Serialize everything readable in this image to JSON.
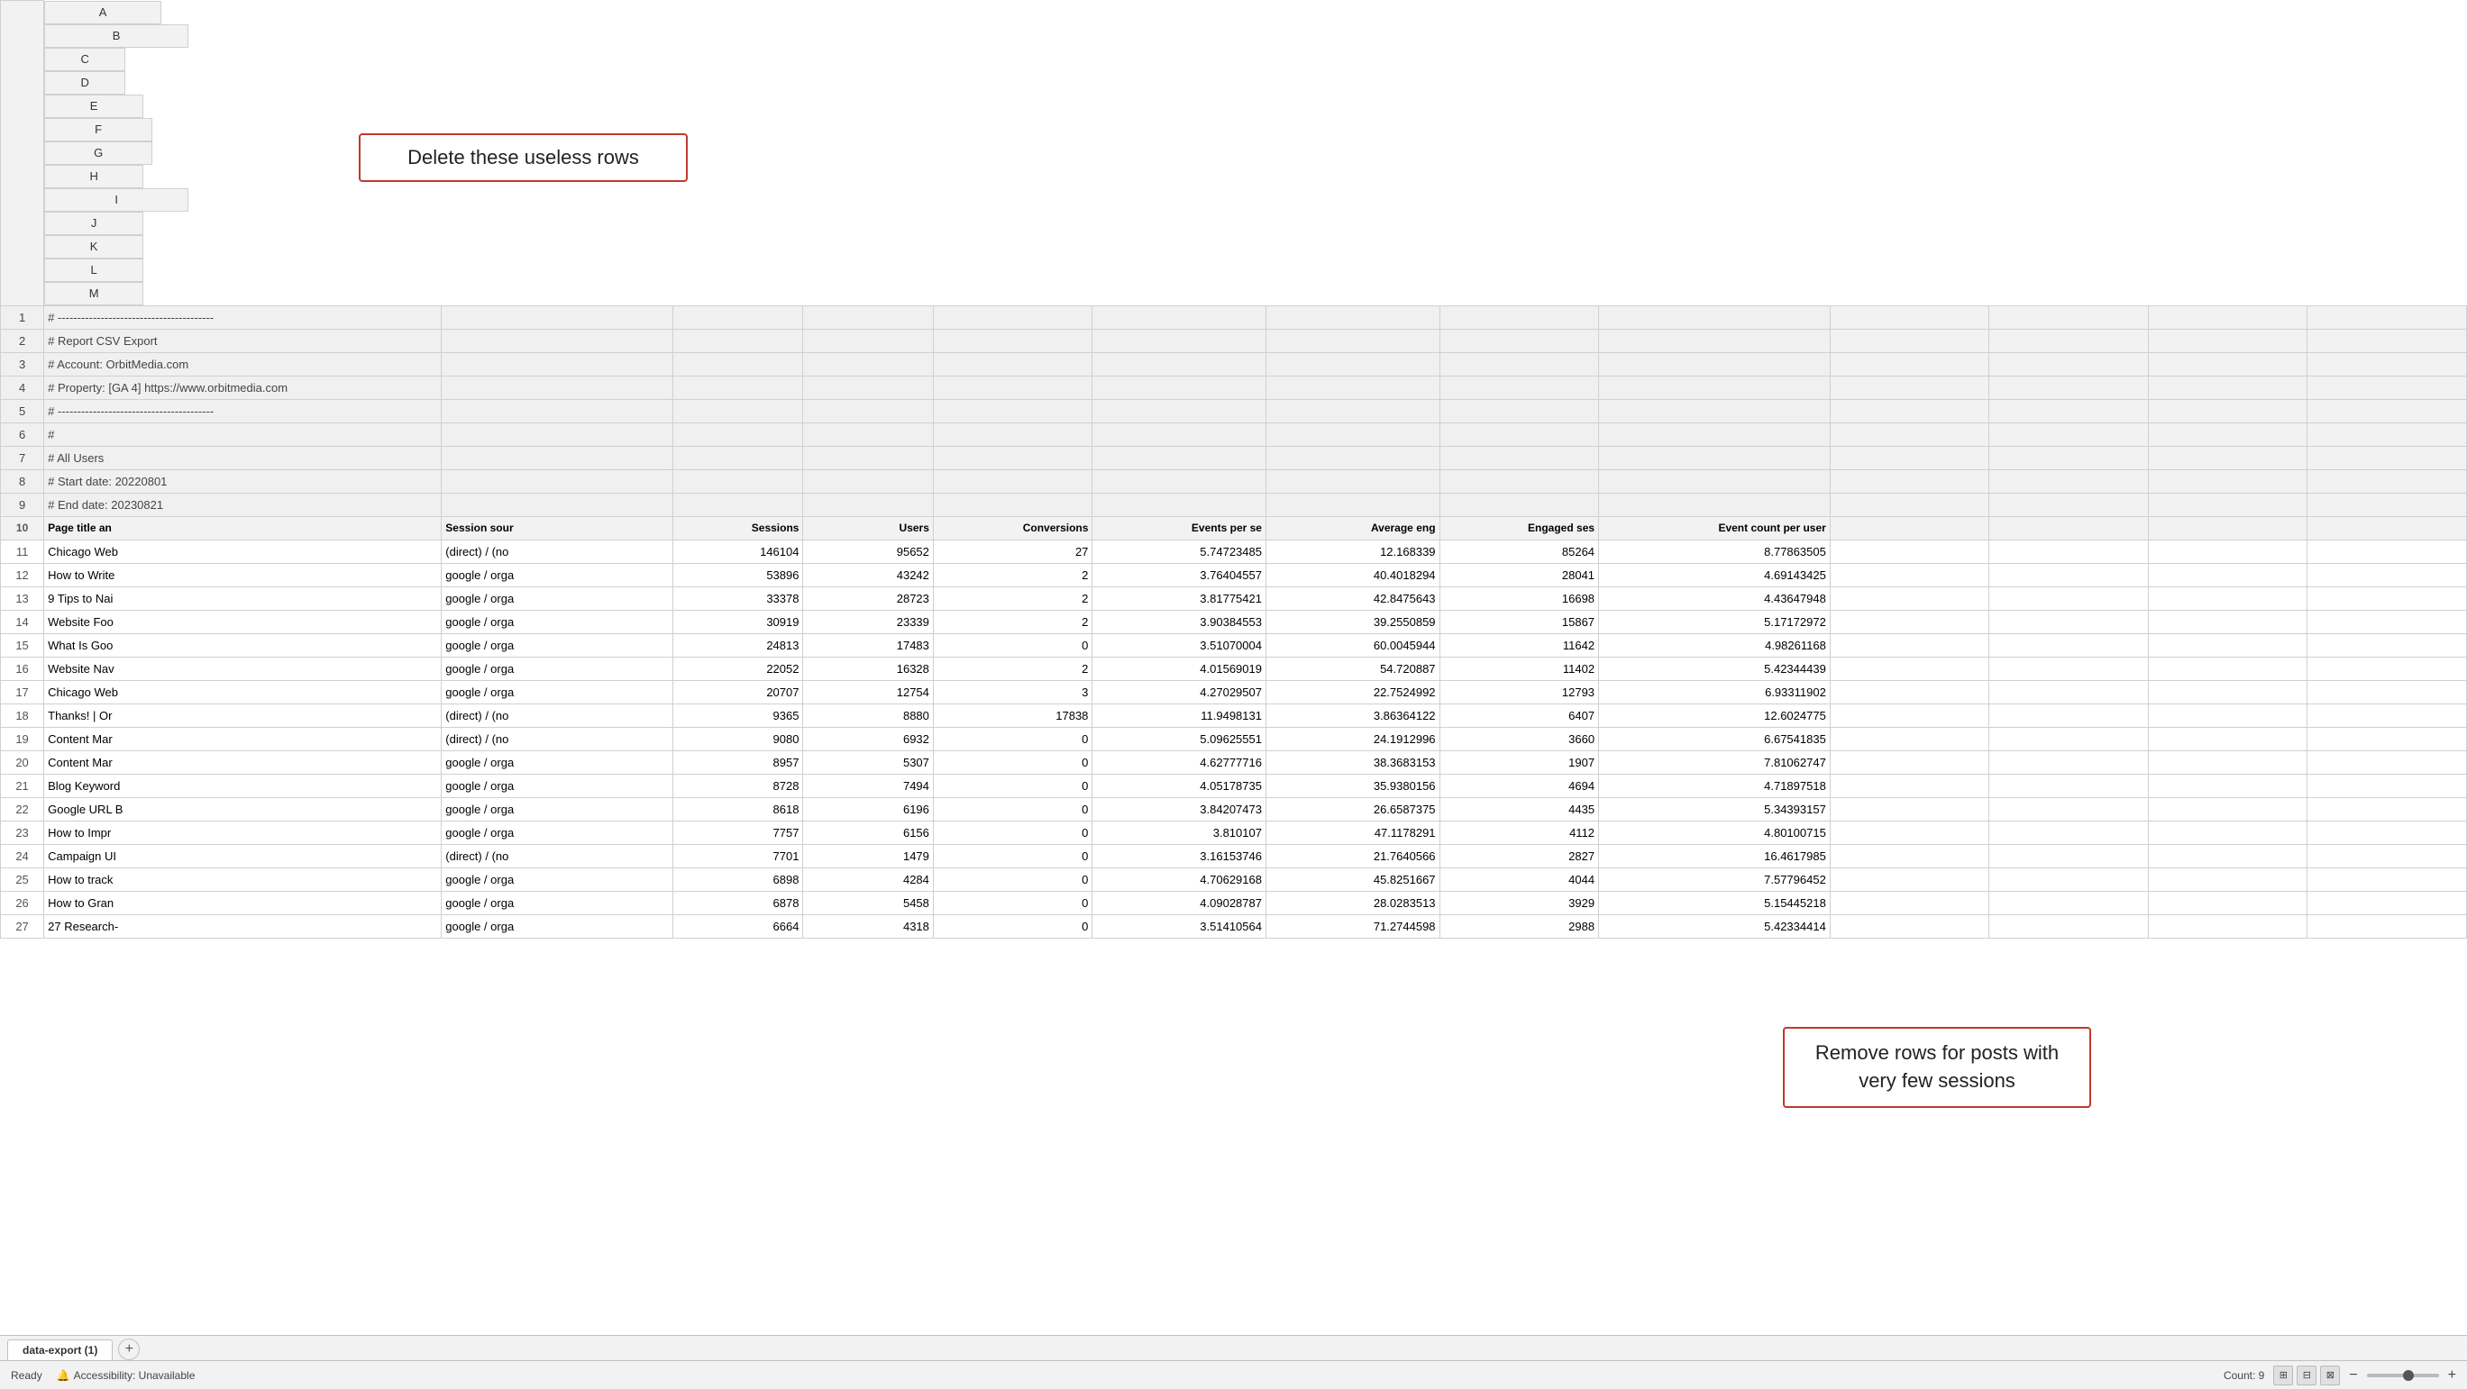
{
  "columns": {
    "row_num": "",
    "A": "A",
    "B": "B",
    "C": "C",
    "D": "D",
    "E": "E",
    "F": "F",
    "G": "G",
    "H": "H",
    "I": "I",
    "J": "J",
    "K": "K",
    "L": "L",
    "M": "M"
  },
  "rows": [
    {
      "num": "1",
      "A": "# ----------------------------------------",
      "B": "",
      "C": "",
      "D": "",
      "E": "",
      "F": "",
      "G": "",
      "H": "",
      "I": "",
      "type": "comment"
    },
    {
      "num": "2",
      "A": "# Report CSV Export",
      "B": "",
      "C": "",
      "D": "",
      "E": "",
      "F": "",
      "G": "",
      "H": "",
      "I": "",
      "type": "comment"
    },
    {
      "num": "3",
      "A": "# Account: OrbitMedia.com",
      "B": "",
      "C": "",
      "D": "",
      "E": "",
      "F": "",
      "G": "",
      "H": "",
      "I": "",
      "type": "comment"
    },
    {
      "num": "4",
      "A": "# Property: [GA 4] https://www.orbitmedia.com",
      "B": "",
      "C": "",
      "D": "",
      "E": "",
      "F": "",
      "G": "",
      "H": "",
      "I": "",
      "type": "comment"
    },
    {
      "num": "5",
      "A": "# ----------------------------------------",
      "B": "",
      "C": "",
      "D": "",
      "E": "",
      "F": "",
      "G": "",
      "H": "",
      "I": "",
      "type": "comment"
    },
    {
      "num": "6",
      "A": "#",
      "B": "",
      "C": "",
      "D": "",
      "E": "",
      "F": "",
      "G": "",
      "H": "",
      "I": "",
      "type": "comment"
    },
    {
      "num": "7",
      "A": "# All Users",
      "B": "",
      "C": "",
      "D": "",
      "E": "",
      "F": "",
      "G": "",
      "H": "",
      "I": "",
      "type": "comment"
    },
    {
      "num": "8",
      "A": "# Start date: 20220801",
      "B": "",
      "C": "",
      "D": "",
      "E": "",
      "F": "",
      "G": "",
      "H": "",
      "I": "",
      "type": "comment"
    },
    {
      "num": "9",
      "A": "# End date: 20230821",
      "B": "",
      "C": "",
      "D": "",
      "E": "",
      "F": "",
      "G": "",
      "H": "",
      "I": "",
      "type": "comment"
    },
    {
      "num": "10",
      "A": "Page title an",
      "B": "Session sour",
      "C": "Sessions",
      "D": "Users",
      "E": "Conversions",
      "F": "Events per se",
      "G": "Average eng",
      "H": "Engaged ses",
      "I": "Event count per user",
      "type": "header"
    },
    {
      "num": "11",
      "A": "Chicago Web",
      "B": "(direct) / (no",
      "C": "146104",
      "D": "95652",
      "E": "27",
      "F": "5.74723485",
      "G": "12.168339",
      "H": "85264",
      "I": "8.77863505",
      "type": "data"
    },
    {
      "num": "12",
      "A": "How to Write",
      "B": "google / orga",
      "C": "53896",
      "D": "43242",
      "E": "2",
      "F": "3.76404557",
      "G": "40.4018294",
      "H": "28041",
      "I": "4.69143425",
      "type": "data"
    },
    {
      "num": "13",
      "A": "9 Tips to Nai",
      "B": "google / orga",
      "C": "33378",
      "D": "28723",
      "E": "2",
      "F": "3.81775421",
      "G": "42.8475643",
      "H": "16698",
      "I": "4.43647948",
      "type": "data"
    },
    {
      "num": "14",
      "A": "Website Foo",
      "B": "google / orga",
      "C": "30919",
      "D": "23339",
      "E": "2",
      "F": "3.90384553",
      "G": "39.2550859",
      "H": "15867",
      "I": "5.17172972",
      "type": "data"
    },
    {
      "num": "15",
      "A": "What Is Goo",
      "B": "google / orga",
      "C": "24813",
      "D": "17483",
      "E": "0",
      "F": "3.51070004",
      "G": "60.0045944",
      "H": "11642",
      "I": "4.98261168",
      "type": "data"
    },
    {
      "num": "16",
      "A": "Website Nav",
      "B": "google / orga",
      "C": "22052",
      "D": "16328",
      "E": "2",
      "F": "4.01569019",
      "G": "54.720887",
      "H": "11402",
      "I": "5.42344439",
      "type": "data"
    },
    {
      "num": "17",
      "A": "Chicago Web",
      "B": "google / orga",
      "C": "20707",
      "D": "12754",
      "E": "3",
      "F": "4.27029507",
      "G": "22.7524992",
      "H": "12793",
      "I": "6.93311902",
      "type": "data"
    },
    {
      "num": "18",
      "A": "Thanks! | Or",
      "B": "(direct) / (no",
      "C": "9365",
      "D": "8880",
      "E": "17838",
      "F": "11.9498131",
      "G": "3.86364122",
      "H": "6407",
      "I": "12.6024775",
      "type": "data"
    },
    {
      "num": "19",
      "A": "Content Mar",
      "B": "(direct) / (no",
      "C": "9080",
      "D": "6932",
      "E": "0",
      "F": "5.09625551",
      "G": "24.1912996",
      "H": "3660",
      "I": "6.67541835",
      "type": "data"
    },
    {
      "num": "20",
      "A": "Content Mar",
      "B": "google / orga",
      "C": "8957",
      "D": "5307",
      "E": "0",
      "F": "4.62777716",
      "G": "38.3683153",
      "H": "1907",
      "I": "7.81062747",
      "type": "data"
    },
    {
      "num": "21",
      "A": "Blog Keyword",
      "B": "google / orga",
      "C": "8728",
      "D": "7494",
      "E": "0",
      "F": "4.05178735",
      "G": "35.9380156",
      "H": "4694",
      "I": "4.71897518",
      "type": "data"
    },
    {
      "num": "22",
      "A": "Google URL B",
      "B": "google / orga",
      "C": "8618",
      "D": "6196",
      "E": "0",
      "F": "3.84207473",
      "G": "26.6587375",
      "H": "4435",
      "I": "5.34393157",
      "type": "data"
    },
    {
      "num": "23",
      "A": "How to Impr",
      "B": "google / orga",
      "C": "7757",
      "D": "6156",
      "E": "0",
      "F": "3.810107",
      "G": "47.1178291",
      "H": "4112",
      "I": "4.80100715",
      "type": "data"
    },
    {
      "num": "24",
      "A": "Campaign UI",
      "B": "(direct) / (no",
      "C": "7701",
      "D": "1479",
      "E": "0",
      "F": "3.16153746",
      "G": "21.7640566",
      "H": "2827",
      "I": "16.4617985",
      "type": "data"
    },
    {
      "num": "25",
      "A": "How to track",
      "B": "google / orga",
      "C": "6898",
      "D": "4284",
      "E": "0",
      "F": "4.70629168",
      "G": "45.8251667",
      "H": "4044",
      "I": "7.57796452",
      "type": "data"
    },
    {
      "num": "26",
      "A": "How to Gran",
      "B": "google / orga",
      "C": "6878",
      "D": "5458",
      "E": "0",
      "F": "4.09028787",
      "G": "28.0283513",
      "H": "3929",
      "I": "5.15445218",
      "type": "data"
    },
    {
      "num": "27",
      "A": "27 Research-",
      "B": "google / orga",
      "C": "6664",
      "D": "4318",
      "E": "0",
      "F": "3.51410564",
      "G": "71.2744598",
      "H": "2988",
      "I": "5.42334414",
      "type": "data"
    }
  ],
  "annotations": {
    "delete_rows": {
      "text": "Delete these useless rows",
      "border_color": "#c0392b"
    },
    "remove_rows": {
      "text": "Remove rows for posts with very few sessions",
      "border_color": "#c0392b"
    }
  },
  "status_bar": {
    "ready": "Ready",
    "accessibility": "Accessibility: Unavailable",
    "count": "Count: 9",
    "zoom_level": "100%"
  },
  "tab": {
    "name": "data-export (1)",
    "add_label": "+"
  }
}
